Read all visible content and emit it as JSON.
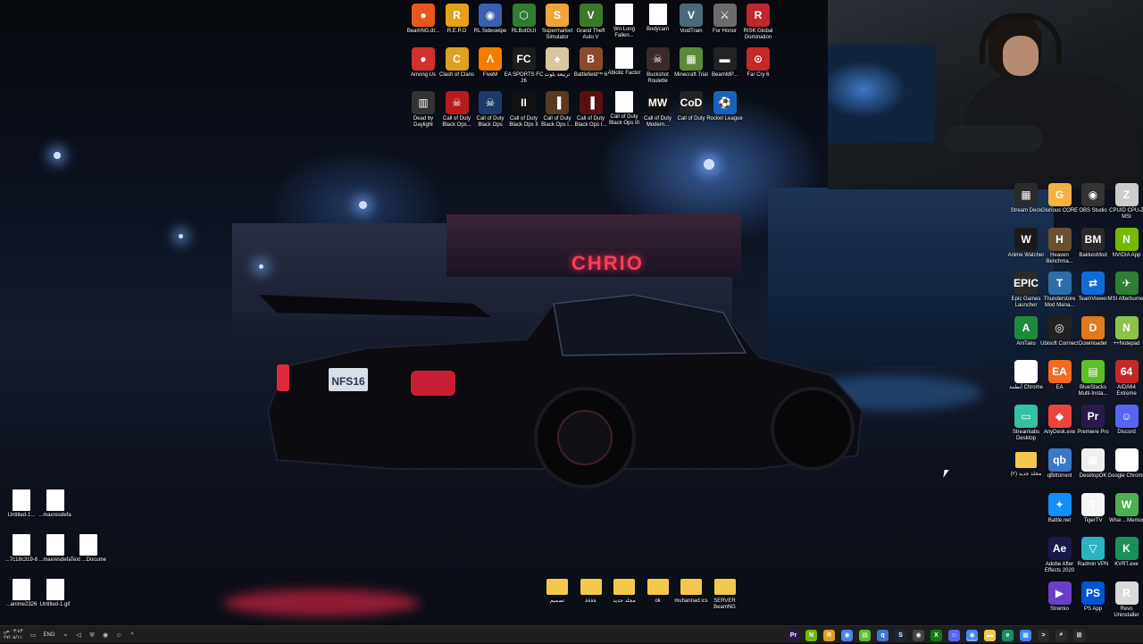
{
  "desktop": {
    "top_icons_row1": [
      {
        "label": "BeamNG.dr...",
        "icon": "beamng-icon",
        "color": "#e8581c",
        "glyph": "●"
      },
      {
        "label": "R.E.P.O",
        "icon": "repo-icon",
        "color": "#e3a21a",
        "glyph": "R"
      },
      {
        "label": "RL Sideswipe",
        "icon": "rl-sideswipe-icon",
        "color": "#3a5fb0",
        "glyph": "◉"
      },
      {
        "label": "RLBotGUI",
        "icon": "rlbot-icon",
        "color": "#2e7d32",
        "glyph": "⬡"
      },
      {
        "label": "Supermarket Simulator",
        "icon": "supermarket-icon",
        "color": "#f1a33c",
        "glyph": "S"
      },
      {
        "label": "Grand Theft Auto V",
        "icon": "gta-icon",
        "color": "#3b7a2e",
        "glyph": "V"
      },
      {
        "label": "Wo Long Fallen...",
        "icon": "file-icon",
        "color": "#ffffff",
        "glyph": ""
      },
      {
        "label": "Bodycam",
        "icon": "file-icon",
        "color": "#ffffff",
        "glyph": ""
      },
      {
        "label": "VoidTrain",
        "icon": "voidtrain-icon",
        "color": "#4a6a7a",
        "glyph": "V"
      },
      {
        "label": "For Honor",
        "icon": "forhonor-icon",
        "color": "#6b6b6b",
        "glyph": "⚔"
      },
      {
        "label": "RISK Global Domination",
        "icon": "risk-icon",
        "color": "#c0262d",
        "glyph": "R"
      }
    ],
    "top_icons_row2": [
      {
        "label": "Among Us",
        "icon": "amongus-icon",
        "color": "#d32f2f",
        "glyph": "●"
      },
      {
        "label": "Clash of Clans",
        "icon": "clash-icon",
        "color": "#e0a021",
        "glyph": "C"
      },
      {
        "label": "FiveM",
        "icon": "fivem-icon",
        "color": "#f57c00",
        "glyph": "Λ"
      },
      {
        "label": "EA SPORTS FC 26",
        "icon": "eafc-icon",
        "color": "#1d1d1d",
        "glyph": "FC"
      },
      {
        "label": "تربيعة بلوت",
        "icon": "baloot-icon",
        "color": "#d9c7a0",
        "glyph": "♠"
      },
      {
        "label": "Battlefield™ 6",
        "icon": "battlefield-icon",
        "color": "#8a4b2a",
        "glyph": "B"
      },
      {
        "label": "Abiotic Factor",
        "icon": "file-icon",
        "color": "#ffffff",
        "glyph": ""
      },
      {
        "label": "Buckshot Roulette",
        "icon": "buckshot-icon",
        "color": "#3a2a2a",
        "glyph": "☠"
      },
      {
        "label": "Minecraft Trial",
        "icon": "minecraft-icon",
        "color": "#5d8a3a",
        "glyph": "▦"
      },
      {
        "label": "BeamMP...",
        "icon": "beammp-icon",
        "color": "#222222",
        "glyph": "▬"
      },
      {
        "label": "Far Cry 6",
        "icon": "farcry-icon",
        "color": "#c62828",
        "glyph": "⊙"
      }
    ],
    "top_icons_row3": [
      {
        "label": "Dead by Daylight",
        "icon": "dbd-icon",
        "color": "#333333",
        "glyph": "▥"
      },
      {
        "label": "Call of Duty Black Ops...",
        "icon": "cod-icon",
        "color": "#b71c1c",
        "glyph": "☠"
      },
      {
        "label": "Call of Duty Black Ops",
        "icon": "cod-icon",
        "color": "#1e3a6b",
        "glyph": "☠"
      },
      {
        "label": "Call of Duty Black Ops II",
        "icon": "cod-icon",
        "color": "#111111",
        "glyph": "II"
      },
      {
        "label": "Call of Duty Black Ops I...",
        "icon": "cod-icon",
        "color": "#5a3a20",
        "glyph": "▐"
      },
      {
        "label": "Call of Duty Black Ops I...",
        "icon": "cod-icon",
        "color": "#5a1010",
        "glyph": "▐"
      },
      {
        "label": "Call of Duty Black Ops III",
        "icon": "file-icon",
        "color": "#ffffff",
        "glyph": ""
      },
      {
        "label": "Call of Duty Modern...",
        "icon": "cod-mw-icon",
        "color": "#111111",
        "glyph": "MW"
      },
      {
        "label": "Call of Duty",
        "icon": "cod-icon",
        "color": "#222222",
        "glyph": "CoD"
      },
      {
        "label": "Rocket League",
        "icon": "rocketleague-icon",
        "color": "#1565c0",
        "glyph": "⚽"
      }
    ],
    "right_icons": [
      [
        {
          "label": "Stream Deck",
          "icon": "streamdeck-icon",
          "color": "#2b2b2b",
          "glyph": "▦"
        },
        {
          "label": "Glorious CORE",
          "icon": "glorious-icon",
          "color": "#f5b041",
          "glyph": "G"
        },
        {
          "label": "OBS Studio",
          "icon": "obs-icon",
          "color": "#333333",
          "glyph": "◉"
        },
        {
          "label": "CPUID CPU-Z MSI",
          "icon": "cpuz-icon",
          "color": "#cccccc",
          "glyph": "Z"
        }
      ],
      [
        {
          "label": "Anime Watcher",
          "icon": "anime-watcher-icon",
          "color": "#1a1a1a",
          "glyph": "W"
        },
        {
          "label": "Heaven Benchma...",
          "icon": "heaven-icon",
          "color": "#6b5030",
          "glyph": "H"
        },
        {
          "label": "BakkesMod",
          "icon": "bakkesmod-icon",
          "color": "#2a2a2a",
          "glyph": "BM"
        },
        {
          "label": "NVIDIA App",
          "icon": "nvidia-icon",
          "color": "#76b900",
          "glyph": "N"
        }
      ],
      [
        {
          "label": "Epic Games Launcher",
          "icon": "epic-icon",
          "color": "#2a2a2a",
          "glyph": "EPIC"
        },
        {
          "label": "Thunderstore Mod Mana...",
          "icon": "thunderstore-icon",
          "color": "#2d6ea8",
          "glyph": "T"
        },
        {
          "label": "TeamViewer",
          "icon": "teamviewer-icon",
          "color": "#0e6bd8",
          "glyph": "⇄"
        },
        {
          "label": "MSI Afterburner",
          "icon": "afterburner-icon",
          "color": "#2e7d32",
          "glyph": "✈"
        }
      ],
      [
        {
          "label": "AniTaku",
          "icon": "anitaku-icon",
          "color": "#1f8a3c",
          "glyph": "A"
        },
        {
          "label": "Ubisoft Connect",
          "icon": "ubisoft-icon",
          "color": "#222222",
          "glyph": "◎"
        },
        {
          "label": "Downloader",
          "icon": "downloader-icon",
          "color": "#e07a1c",
          "glyph": "D"
        },
        {
          "label": "++Notepad",
          "icon": "notepadpp-icon",
          "color": "#8bc34a",
          "glyph": "N"
        }
      ],
      [
        {
          "label": "أنظمة Chrome",
          "icon": "chrome-icon",
          "color": "#ffffff",
          "glyph": "◉"
        },
        {
          "label": "EA",
          "icon": "ea-icon",
          "color": "#f26b21",
          "glyph": "EA"
        },
        {
          "label": "BlueStacks Multi-Insta...",
          "icon": "bluestacks-icon",
          "color": "#5cbf2a",
          "glyph": "▤"
        },
        {
          "label": "AIDA64 Extreme",
          "icon": "aida64-icon",
          "color": "#c62828",
          "glyph": "64"
        }
      ],
      [
        {
          "label": "Streamlabs Desktop",
          "icon": "streamlabs-icon",
          "color": "#31c3a2",
          "glyph": "▭"
        },
        {
          "label": "AnyDesk.exe",
          "icon": "anydesk-icon",
          "color": "#ef443b",
          "glyph": "◆"
        },
        {
          "label": "Premiere Pro",
          "icon": "premiere-icon",
          "color": "#2a1a4a",
          "glyph": "Pr"
        },
        {
          "label": "Discord",
          "icon": "discord-icon",
          "color": "#5865f2",
          "glyph": "☺"
        }
      ],
      [
        {
          "label": "مجلد جديد (٢)",
          "icon": "folder-icon",
          "color": "#f2c94c",
          "glyph": ""
        },
        {
          "label": "qBittorrent",
          "icon": "qbittorrent-icon",
          "color": "#3c78c8",
          "glyph": "qb"
        },
        {
          "label": "DesktopOK",
          "icon": "desktopok-icon",
          "color": "#eeeeee",
          "glyph": "▦"
        },
        {
          "label": "Google Chrome",
          "icon": "chrome-icon",
          "color": "#ffffff",
          "glyph": "◉"
        }
      ],
      [
        {
          "label": "",
          "icon": "",
          "color": "",
          "glyph": ""
        },
        {
          "label": "Battle.net",
          "icon": "battlenet-icon",
          "color": "#148eff",
          "glyph": "✦"
        },
        {
          "label": "TigerTV",
          "icon": "tigertv-icon",
          "color": "#f5f5f5",
          "glyph": "T"
        },
        {
          "label": "Wise ...Memor",
          "icon": "wisememory-icon",
          "color": "#4caf50",
          "glyph": "W"
        }
      ],
      [
        {
          "label": "",
          "icon": "",
          "color": "",
          "glyph": ""
        },
        {
          "label": "Adobe After Effects 2020",
          "icon": "aftereffects-icon",
          "color": "#1a1a4a",
          "glyph": "Ae"
        },
        {
          "label": "Radmin VPN",
          "icon": "radmin-icon",
          "color": "#2bb3c0",
          "glyph": "▽"
        },
        {
          "label": "KVRT.exe",
          "icon": "kvrt-icon",
          "color": "#1b8f5a",
          "glyph": "K"
        }
      ],
      [
        {
          "label": "",
          "icon": "",
          "color": "",
          "glyph": ""
        },
        {
          "label": "Stremio",
          "icon": "stremio-icon",
          "color": "#6a3fc8",
          "glyph": "▶"
        },
        {
          "label": "PS App",
          "icon": "psapp-icon",
          "color": "#0055d4",
          "glyph": "PS"
        },
        {
          "label": "Revo Uninstaller",
          "icon": "revo-icon",
          "color": "#d9d9d9",
          "glyph": "R"
        }
      ]
    ],
    "left_icons": [
      [
        {
          "label": "Untitled-1...",
          "icon": "file-icon"
        },
        {
          "label": "...maxresdefa",
          "icon": "file-icon"
        }
      ],
      [
        {
          "label": "...7c18c319-6",
          "icon": "file-icon"
        },
        {
          "label": "...maxresdefa",
          "icon": "file-icon"
        },
        {
          "label": "Text ...Docume",
          "icon": "file-icon"
        }
      ],
      [
        {
          "label": "...anime2326",
          "icon": "file-icon"
        },
        {
          "label": "Untitled-1.gif",
          "icon": "file-icon"
        }
      ]
    ],
    "bottom_folders": [
      {
        "label": "تصميم"
      },
      {
        "label": "ةةةة"
      },
      {
        "label": "مجلد جديد"
      },
      {
        "label": "ok"
      },
      {
        "label": "muhannad ics"
      },
      {
        "label": "SERVER BeamNG"
      }
    ]
  },
  "taskbar": {
    "clock_time": "٠٣:٤٣ ص",
    "clock_date": "٢٧/٠٨/١١",
    "language": "ENG",
    "tray_icons": [
      "shield-icon",
      "notification-icon",
      "volume-icon",
      "network-icon",
      "overflow-icon"
    ],
    "pinned": [
      {
        "icon": "premiere-icon",
        "color": "#2a1a4a",
        "glyph": "Pr"
      },
      {
        "icon": "nvidia-icon",
        "color": "#76b900",
        "glyph": "N"
      },
      {
        "icon": "repo-icon",
        "color": "#e3a21a",
        "glyph": "R"
      },
      {
        "icon": "chrome-icon",
        "color": "#4285f4",
        "glyph": "◉"
      },
      {
        "icon": "bluestacks-icon",
        "color": "#5cbf2a",
        "glyph": "▤"
      },
      {
        "icon": "qbittorrent-icon",
        "color": "#3c78c8",
        "glyph": "q"
      },
      {
        "icon": "steam-icon",
        "color": "#1b2838",
        "glyph": "S"
      },
      {
        "icon": "obs-icon",
        "color": "#444444",
        "glyph": "◉"
      },
      {
        "icon": "xbox-icon",
        "color": "#107c10",
        "glyph": "X"
      },
      {
        "icon": "discord-icon",
        "color": "#5865f2",
        "glyph": "☺"
      },
      {
        "icon": "chrome-icon",
        "color": "#4285f4",
        "glyph": "◉"
      },
      {
        "icon": "folder-icon",
        "color": "#f2c94c",
        "glyph": "▬"
      },
      {
        "icon": "edge-icon",
        "color": "#0f8f6a",
        "glyph": "e"
      },
      {
        "icon": "store-icon",
        "color": "#3a86ff",
        "glyph": "▦"
      },
      {
        "icon": "terminal-icon",
        "color": "#2b2b2b",
        "glyph": ">"
      },
      {
        "icon": "search-icon",
        "color": "#2b2b2b",
        "glyph": "⌕"
      },
      {
        "icon": "windows-icon",
        "color": "#2b2b2b",
        "glyph": "⊞"
      }
    ]
  },
  "wallpaper": {
    "sign_text": "CHRIO",
    "plate_text": "NFS16"
  }
}
